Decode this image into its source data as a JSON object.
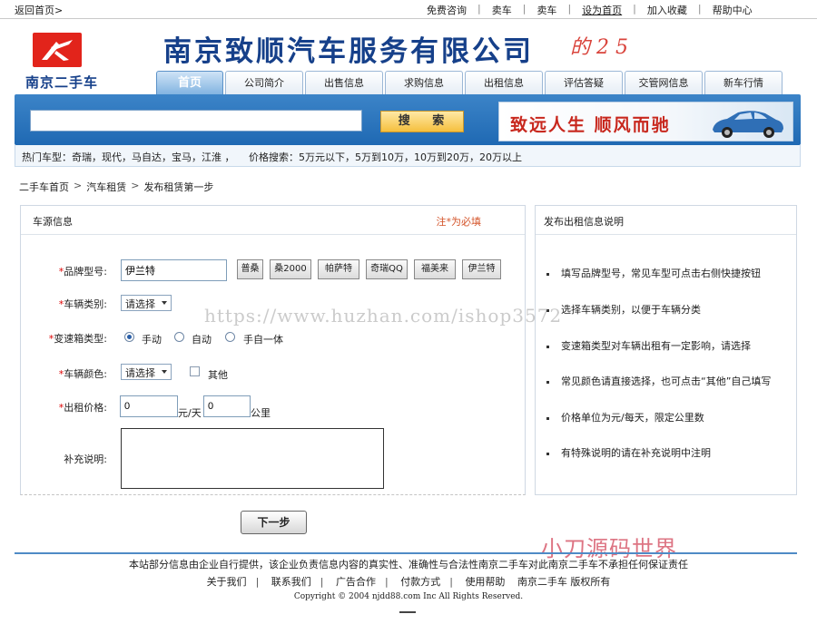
{
  "topbar": {
    "back": "返回首页>",
    "links": [
      "免费咨询",
      "卖车",
      "卖车",
      "设为首页",
      "加入收藏",
      "帮助中心"
    ]
  },
  "header": {
    "logo_text": "南京二手车",
    "company": "南京致顺汽车服务有限公司",
    "scribble": "的 2 5"
  },
  "tabs": [
    "首页",
    "公司简介",
    "出售信息",
    "求购信息",
    "出租信息",
    "评估答疑",
    "交管网信息",
    "新车行情"
  ],
  "search": {
    "value": "",
    "button": "搜 索"
  },
  "banner": {
    "slogan": "致远人生  顺风而驰"
  },
  "hotbar": {
    "hot": "热门车型：奇瑞，现代，马自达，宝马，江淮 ，",
    "price": "价格搜索：5万元以下，5万到10万，10万到20万，20万以上"
  },
  "breadcrumb": [
    "二手车首页",
    "汽车租赁",
    "发布租赁第一步"
  ],
  "form": {
    "title": "车源信息",
    "required_note": "注*为必填",
    "brand_label": "品牌型号:",
    "brand_value": "伊兰特",
    "brand_buttons": [
      "普桑",
      "桑2000",
      "帕萨特",
      "奇瑞QQ",
      "福美来",
      "伊兰特"
    ],
    "type_label": "车辆类别:",
    "type_value": "请选择",
    "gear_label": "变速箱类型:",
    "gear_options": [
      "手动",
      "自动",
      "手自一体"
    ],
    "color_label": "车辆颜色:",
    "color_value": "请选择",
    "color_other": "其他",
    "price_label": "出租价格:",
    "price_value": "0",
    "price_unit": "元/天",
    "km_value": "0",
    "km_unit": "公里",
    "note_label": "补充说明:",
    "next": "下一步"
  },
  "help": {
    "title": "发布出租信息说明",
    "items": [
      "填写品牌型号，常见车型可点击右侧快捷按钮",
      "选择车辆类别，以便于车辆分类",
      "变速箱类型对车辆出租有一定影响，请选择",
      "常见颜色请直接选择，也可点击“其他”自己填写",
      "价格单位为元/每天，限定公里数",
      "有特殊说明的请在补充说明中注明"
    ]
  },
  "watermark": "https://www.huzhan.com/ishop3572",
  "watermark2": "小刀源码世界",
  "footer": {
    "disclaimer": "本站部分信息由企业自行提供，该企业负责信息内容的真实性、准确性与合法性南京二手车对此南京二手车不承担任何保证责任",
    "links": [
      "关于我们",
      "联系我们",
      "广告合作",
      "付款方式",
      "使用帮助"
    ],
    "brand_right": "南京二手车 版权所有",
    "copyright": "Copyright © 2004 njdd88.com Inc All Rights Reserved."
  }
}
